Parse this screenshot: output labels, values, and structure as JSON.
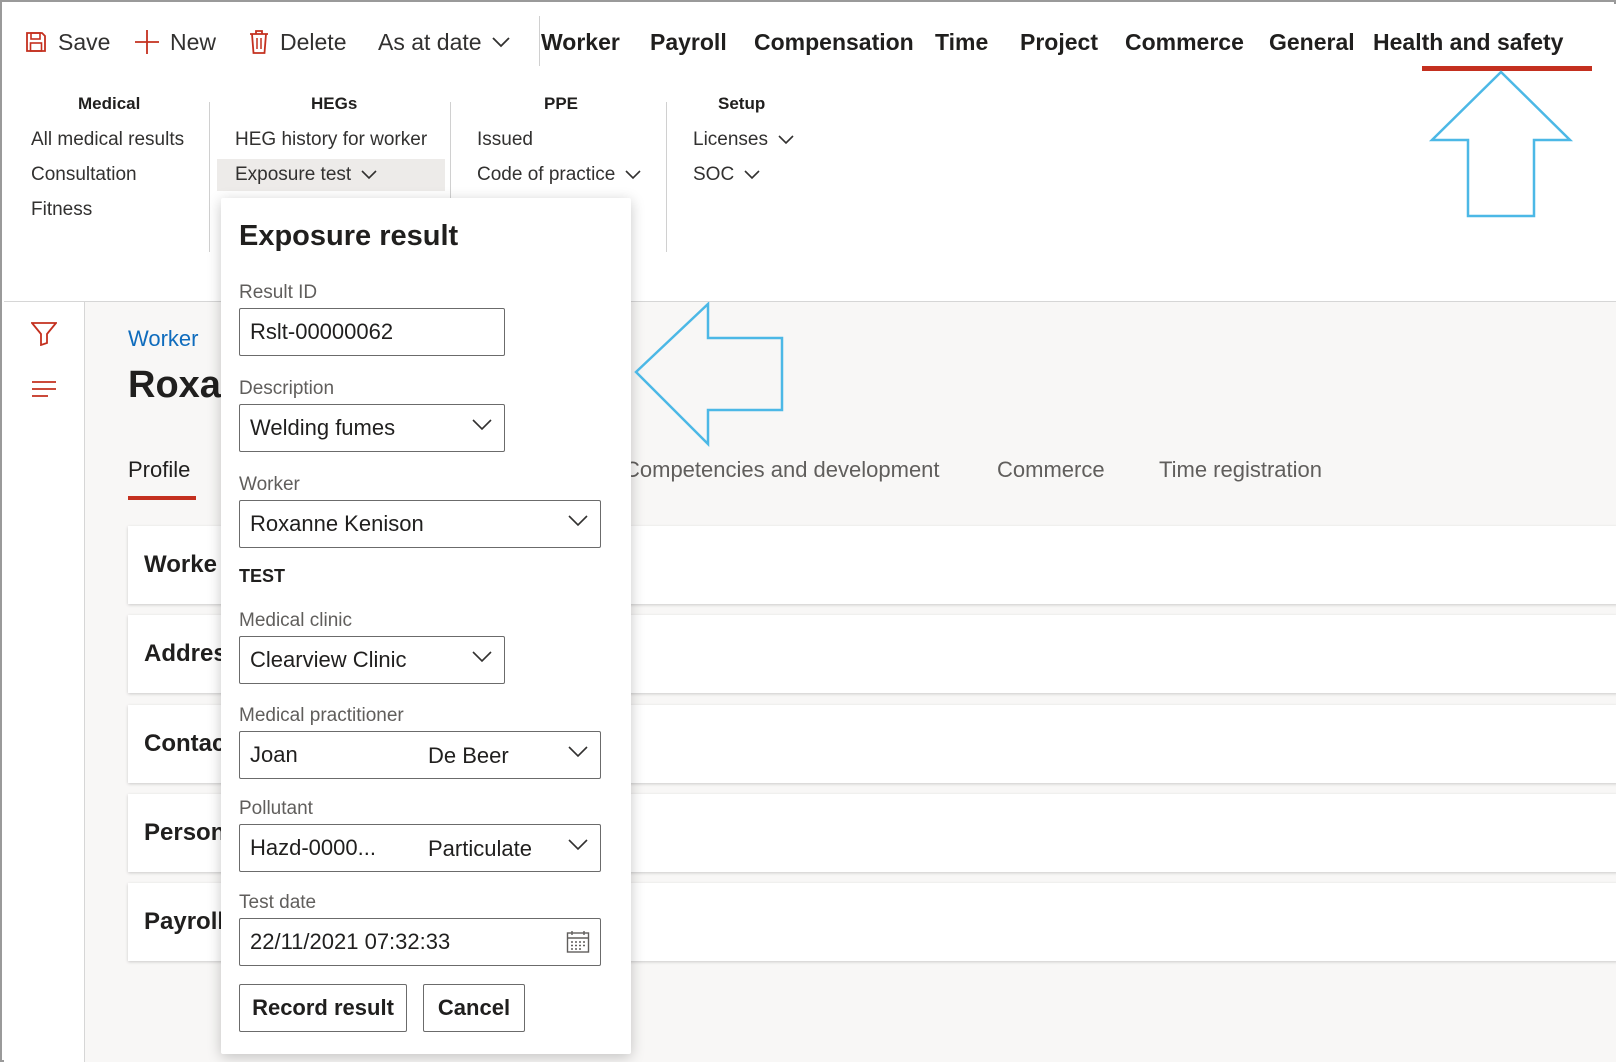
{
  "commands": {
    "save": "Save",
    "new": "New",
    "delete": "Delete",
    "as_at_date": "As at date"
  },
  "tabs": [
    "Worker",
    "Payroll",
    "Compensation",
    "Time",
    "Project",
    "Commerce",
    "General",
    "Health and safety"
  ],
  "active_tab": "Health and safety",
  "ribbon": {
    "medical": {
      "title": "Medical",
      "items": [
        "All medical results",
        "Consultation",
        "Fitness"
      ]
    },
    "hegs": {
      "title": "HEGs",
      "items": [
        "HEG history for worker",
        "Exposure test"
      ]
    },
    "ppe": {
      "title": "PPE",
      "items": [
        "Issued",
        "Code of practice"
      ]
    },
    "setup": {
      "title": "Setup",
      "items": [
        "Licenses",
        "SOC"
      ]
    }
  },
  "page": {
    "breadcrumb": "Worker",
    "title_visible": "Roxar",
    "tabs": [
      "Profile",
      "Competencies and development",
      "Commerce",
      "Time registration"
    ],
    "fasttabs": [
      "Worke",
      "Addres",
      "Contac",
      "Person",
      "Payroll"
    ]
  },
  "exposure_result": {
    "title": "Exposure result",
    "result_id_label": "Result ID",
    "result_id": "Rslt-00000062",
    "description_label": "Description",
    "description": "Welding fumes",
    "worker_label": "Worker",
    "worker": "Roxanne Kenison",
    "section": "TEST",
    "clinic_label": "Medical clinic",
    "clinic": "Clearview Clinic",
    "practitioner_label": "Medical practitioner",
    "practitioner_first": "Joan",
    "practitioner_last": "De Beer",
    "pollutant_label": "Pollutant",
    "pollutant_id": "Hazd-0000...",
    "pollutant_name": "Particulate",
    "test_date_label": "Test date",
    "test_date": "22/11/2021 07:32:33",
    "record_button": "Record result",
    "cancel_button": "Cancel"
  },
  "colors": {
    "accent_red": "#c4301f",
    "link_blue": "#0f6cbd",
    "annotation_arrow": "#4cb8e6"
  }
}
